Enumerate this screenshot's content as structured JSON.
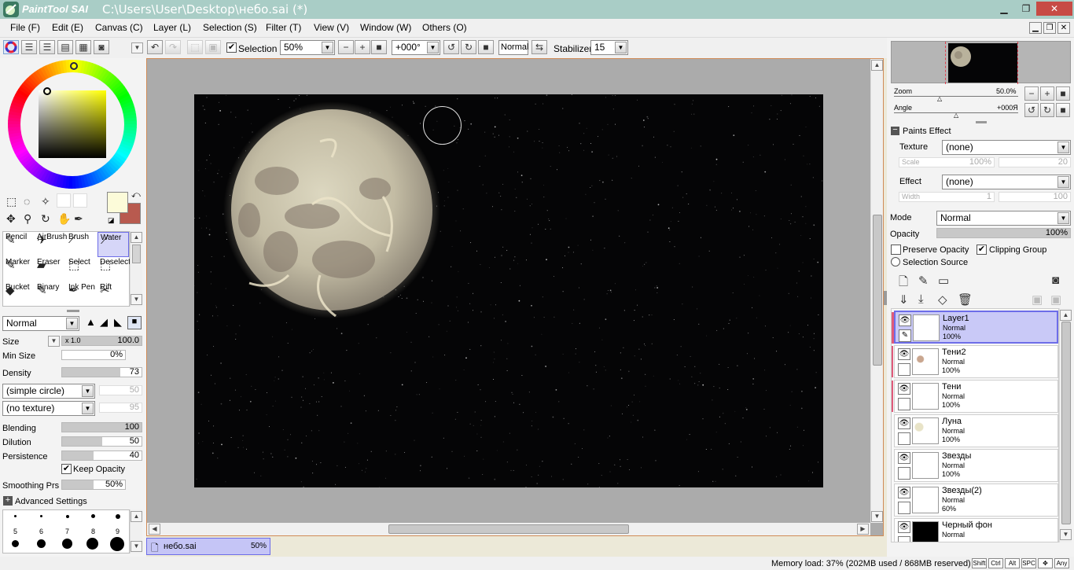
{
  "titlebar": {
    "logo_text": "PaintTool SAI",
    "title": "C:\\Users\\User\\Desktop\\небо.sai (*)",
    "minimize": "▁",
    "maximize": "❐",
    "close": "✕"
  },
  "menu": [
    {
      "label": "File (F)"
    },
    {
      "label": "Edit (E)"
    },
    {
      "label": "Canvas (C)"
    },
    {
      "label": "Layer (L)"
    },
    {
      "label": "Selection (S)"
    },
    {
      "label": "Filter (T)"
    },
    {
      "label": "View (V)"
    },
    {
      "label": "Window (W)"
    },
    {
      "label": "Others (O)"
    }
  ],
  "toolbar": {
    "selection_label": "Selection",
    "selection_checked": true,
    "zoom": "50%",
    "angle": "+000°",
    "blend_mode": "Normal",
    "stabilizer_label": "Stabilizer",
    "stabilizer_value": "15"
  },
  "tools": [
    {
      "label": "Pencil",
      "icon": "pencil-icon",
      "glyph": "✎"
    },
    {
      "label": "AirBrush",
      "icon": "airbrush-icon",
      "glyph": "✈"
    },
    {
      "label": "Brush",
      "icon": "brush-icon",
      "glyph": "⟋"
    },
    {
      "label": "Water",
      "icon": "water-icon",
      "glyph": "⟋",
      "selected": true
    },
    {
      "label": "Marker",
      "icon": "marker-icon",
      "glyph": "✎"
    },
    {
      "label": "Eraser",
      "icon": "eraser-icon",
      "glyph": "▰"
    },
    {
      "label": "Select",
      "icon": "select-icon",
      "glyph": "⬚"
    },
    {
      "label": "Deselect",
      "icon": "deselect-icon",
      "glyph": "⬚"
    },
    {
      "label": "Bucket",
      "icon": "bucket-icon",
      "glyph": "◆"
    },
    {
      "label": "Binary",
      "icon": "binary-icon",
      "glyph": "✎"
    },
    {
      "label": "Ink Pen",
      "icon": "ink-pen-icon",
      "glyph": "✒"
    },
    {
      "label": "Rift",
      "icon": "rift-icon",
      "glyph": "✂"
    }
  ],
  "brush": {
    "mode": "Normal",
    "size_label": "Size",
    "size_mult": "x 1.0",
    "size_value": "100.0",
    "minsize_label": "Min Size",
    "minsize_value": "0%",
    "density_label": "Density",
    "density_value": "73",
    "density_fraction": 0.73,
    "shape": "(simple circle)",
    "shape_value": "50",
    "texture": "(no texture)",
    "texture_value": "95",
    "blending_label": "Blending",
    "blending_value": "100",
    "blending_fraction": 1.0,
    "dilution_label": "Dilution",
    "dilution_value": "50",
    "dilution_fraction": 0.5,
    "persistence_label": "Persistence",
    "persistence_value": "40",
    "persistence_fraction": 0.4,
    "keep_opacity_label": "Keep Opacity",
    "keep_opacity_checked": true,
    "smoothing_label": "Smoothing Prs",
    "smoothing_value": "50%",
    "advanced_label": "Advanced Settings"
  },
  "brush_sizes": [
    "5",
    "6",
    "7",
    "8",
    "9"
  ],
  "colors": {
    "primary": "#fcfbd9",
    "secondary": "#b85a4f",
    "accent": "#6d6de8",
    "title_bg": "#a9cdc6"
  },
  "navigator": {
    "zoom_label": "Zoom",
    "zoom_value": "50.0%",
    "angle_label": "Angle",
    "angle_value": "+000Я"
  },
  "paints_effect": {
    "header": "Paints Effect",
    "texture_label": "Texture",
    "texture_value": "(none)",
    "scale_label": "Scale",
    "scale_value": "100%",
    "scale_num": "20",
    "effect_label": "Effect",
    "effect_value": "(none)",
    "width_label": "Width",
    "width_value": "1",
    "width_num": "100"
  },
  "layer_props": {
    "mode_label": "Mode",
    "mode_value": "Normal",
    "opacity_label": "Opacity",
    "opacity_value": "100%",
    "preserve_opacity_label": "Preserve Opacity",
    "preserve_opacity_checked": false,
    "clipping_group_label": "Clipping Group",
    "clipping_group_checked": true,
    "selection_source_label": "Selection Source"
  },
  "layers": [
    {
      "name": "Layer1",
      "mode": "Normal",
      "opacity": "100%",
      "selected": true,
      "marked": true,
      "thumb": "white"
    },
    {
      "name": "Тени2",
      "mode": "Normal",
      "opacity": "100%",
      "selected": false,
      "marked": true,
      "thumb": "smudge"
    },
    {
      "name": "Тени",
      "mode": "Normal",
      "opacity": "100%",
      "selected": false,
      "marked": true,
      "thumb": "white"
    },
    {
      "name": "Луна",
      "mode": "Normal",
      "opacity": "100%",
      "selected": false,
      "marked": false,
      "thumb": "moon"
    },
    {
      "name": "Звезды",
      "mode": "Normal",
      "opacity": "100%",
      "selected": false,
      "marked": false,
      "thumb": "white"
    },
    {
      "name": "Звезды(2)",
      "mode": "Normal",
      "opacity": "60%",
      "selected": false,
      "marked": false,
      "thumb": "white"
    },
    {
      "name": "Черный фон",
      "mode": "Normal",
      "opacity": "",
      "selected": false,
      "marked": false,
      "thumb": "black"
    }
  ],
  "document_tab": {
    "name": "небо.sai",
    "zoom": "50%"
  },
  "status": {
    "memory": "Memory load: 37% (202MB used / 868MB reserved)",
    "keys": [
      "Shift",
      "Ctrl",
      "Alt",
      "SPC",
      "✥",
      "Any"
    ]
  }
}
